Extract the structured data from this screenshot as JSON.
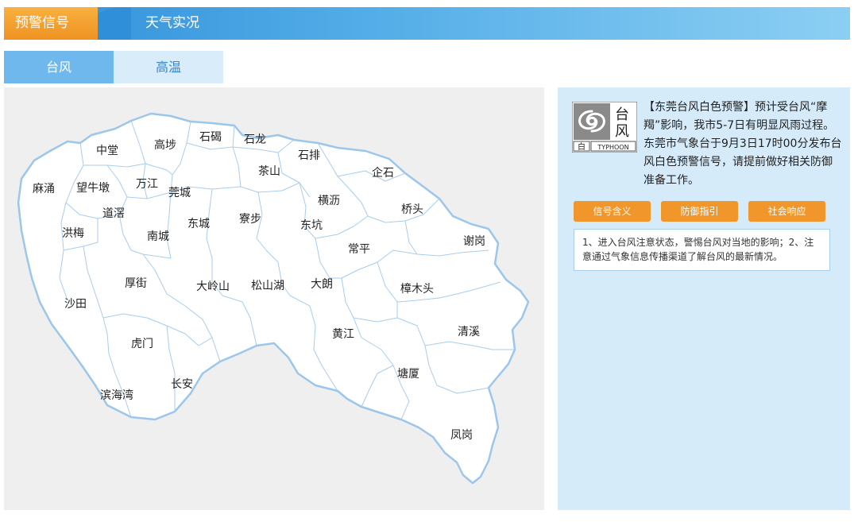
{
  "header": {
    "active_tab": "预警信号",
    "inactive_tab": "天气实况"
  },
  "subtabs": [
    {
      "label": "台风",
      "active": true
    },
    {
      "label": "高温",
      "active": false
    }
  ],
  "map": {
    "towns": [
      "中堂",
      "高埗",
      "石碣",
      "石龙",
      "石排",
      "企石",
      "茶山",
      "麻涌",
      "望牛墩",
      "万江",
      "莞城",
      "横沥",
      "道滘",
      "东城",
      "寮步",
      "东坑",
      "桥头",
      "洪梅",
      "南城",
      "谢岗",
      "常平",
      "厚街",
      "大岭山",
      "松山湖",
      "大朗",
      "樟木头",
      "沙田",
      "黄江",
      "清溪",
      "虎门",
      "塘厦",
      "长安",
      "滨海湾",
      "凤岗"
    ]
  },
  "warning": {
    "icon": {
      "name": "typhoon-icon",
      "char_top": "台",
      "char_bottom": "风",
      "level_char": "白",
      "en_label": "TYPHOON"
    },
    "text": "【东莞台风白色预警】预计受台风“摩羯”影响，我市5-7日有明显风雨过程。东莞市气象台于9月3日17时00分发布台风白色预警信号，请提前做好相关防御准备工作。",
    "buttons": [
      "信号含义",
      "防御指引",
      "社会响应"
    ],
    "description": "1、进入台风注意状态，警惕台风对当地的影响；2、注意通过气象信息传播渠道了解台风的最新情况。"
  },
  "colors": {
    "accent_orange": "#f0962a",
    "header_blue": "#2f8fd8",
    "panel_bg": "#d5ebfa",
    "map_border": "#8fbde6"
  }
}
